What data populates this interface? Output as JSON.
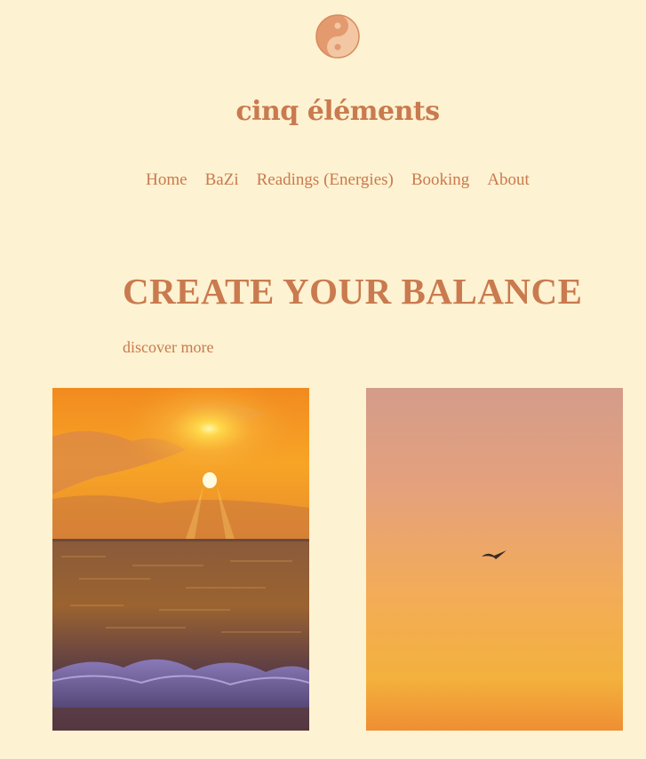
{
  "site": {
    "logo_icon": "yin-yang-icon",
    "brand_name": "cinq éléments"
  },
  "nav": {
    "items": [
      {
        "label": "Home"
      },
      {
        "label": "BaZi"
      },
      {
        "label": "Readings (Energies)"
      },
      {
        "label": "Booking"
      },
      {
        "label": "About"
      }
    ]
  },
  "hero": {
    "headline": "CREATE YOUR BALANCE",
    "cta_label": "discover more"
  },
  "gallery": {
    "images": [
      {
        "subject": "sunset-over-sea-waves"
      },
      {
        "subject": "seagull-in-orange-sky"
      }
    ]
  },
  "colors": {
    "background": "#fdf2d1",
    "accent": "#c97a4f"
  }
}
